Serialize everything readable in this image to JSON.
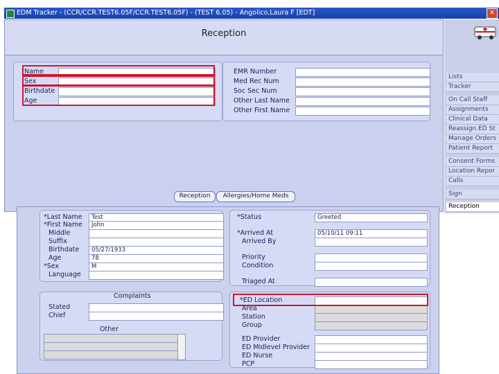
{
  "window": {
    "title": "EDM Tracker - (CCR/CCR.TEST6.05F/CCR.TEST6.05F) - (TEST 6.05) - Angolico,Laura F [EDT]",
    "close": "✕"
  },
  "top": {
    "title": "Reception",
    "left_fields": [
      {
        "label": "Name",
        "value": ""
      },
      {
        "label": "Sex",
        "value": ""
      },
      {
        "label": "Birthdate",
        "value": ""
      },
      {
        "label": "Age",
        "value": ""
      }
    ],
    "right_fields": [
      {
        "label": "EMR Number",
        "value": ""
      },
      {
        "label": "Med Rec Num",
        "value": ""
      },
      {
        "label": "Soc Sec Num",
        "value": ""
      },
      {
        "label": "Other Last Name",
        "value": ""
      },
      {
        "label": "Other First Name",
        "value": ""
      }
    ],
    "tabs": [
      "Reception",
      "Allergies/Home Meds"
    ]
  },
  "sidebar": {
    "items": [
      "Lists",
      "Tracker",
      "On Call Staff",
      "Assignments",
      "Clinical Data",
      "Reassign ED St",
      "Manage Orders",
      "Patient Report",
      "Consent Forms",
      "Location Repor",
      "Calls",
      "Sign",
      "Reception"
    ]
  },
  "bottom": {
    "patient": [
      {
        "label": "*Last Name",
        "value": "Test"
      },
      {
        "label": "*First Name",
        "value": "John"
      },
      {
        "label": "Middle",
        "value": ""
      },
      {
        "label": "Suffix",
        "value": ""
      },
      {
        "label": "Birthdate",
        "value": "05/27/1933"
      },
      {
        "label": "Age",
        "value": "78"
      },
      {
        "label": "*Sex",
        "value": "M"
      },
      {
        "label": "Language",
        "value": ""
      }
    ],
    "status": [
      {
        "label": "*Status",
        "value": "Greeted"
      },
      {
        "label": "*Arrived At",
        "value": "05/10/11 09:11"
      },
      {
        "label": "Arrived By",
        "value": ""
      },
      {
        "label": "Priority",
        "value": ""
      },
      {
        "label": "Condition",
        "value": ""
      },
      {
        "label": "Triaged At",
        "value": ""
      }
    ],
    "complaints": {
      "title": "Complaints",
      "stated": "Stated",
      "chief": "Chief",
      "other": "Other"
    },
    "location": [
      {
        "label": "*ED Location",
        "value": ""
      },
      {
        "label": "Area",
        "value": ""
      },
      {
        "label": "Station",
        "value": ""
      },
      {
        "label": "Group",
        "value": ""
      },
      {
        "label": "ED Provider",
        "value": ""
      },
      {
        "label": "ED Midlevel Provider",
        "value": ""
      },
      {
        "label": "ED Nurse",
        "value": ""
      },
      {
        "label": "PCP",
        "value": ""
      }
    ]
  },
  "colors": {
    "highlight": "#d0142c",
    "titlebar": "#1f4fbf",
    "panel": "#d6dbf5"
  }
}
